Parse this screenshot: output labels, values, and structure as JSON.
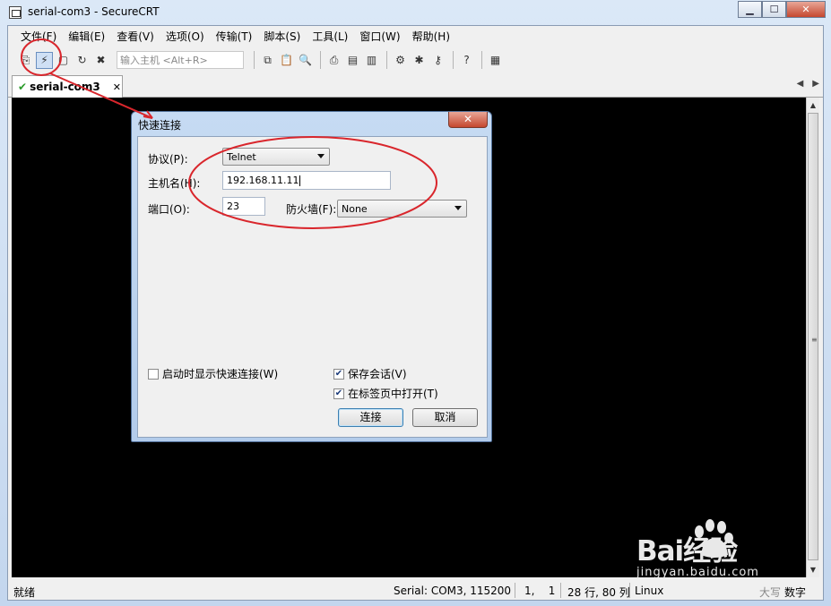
{
  "window": {
    "title": "serial-com3 - SecureCRT"
  },
  "menu": [
    "文件(F)",
    "编辑(E)",
    "查看(V)",
    "选项(O)",
    "传输(T)",
    "脚本(S)",
    "工具(L)",
    "窗口(W)",
    "帮助(H)"
  ],
  "toolbar": {
    "quick_connect_placeholder": "输入主机 <Alt+R>"
  },
  "tab": {
    "label": "serial-com3"
  },
  "status": {
    "ready": "就绪",
    "serial": "Serial: COM3, 115200",
    "cursor": "1,    1",
    "size": "28 行, 80 列",
    "os": "Linux",
    "caps": "大写",
    "num": "数字"
  },
  "dialog": {
    "title": "快速连接",
    "protocol_label": "协议(P):",
    "protocol_value": "Telnet",
    "hostname_label": "主机名(H):",
    "hostname_value": "192.168.11.11",
    "port_label": "端口(O):",
    "port_value": "23",
    "firewall_label": "防火墙(F):",
    "firewall_value": "None",
    "show_on_startup_label": "启动时显示快速连接(W)",
    "show_on_startup_checked": false,
    "save_session_label": "保存会话(V)",
    "save_session_checked": true,
    "open_in_tab_label": "在标签页中打开(T)",
    "open_in_tab_checked": true,
    "connect_button": "连接",
    "cancel_button": "取消"
  },
  "watermark": {
    "brand": "Bai经验",
    "url": "jingyan.baidu.com"
  },
  "annotation_color": "#d9262c"
}
